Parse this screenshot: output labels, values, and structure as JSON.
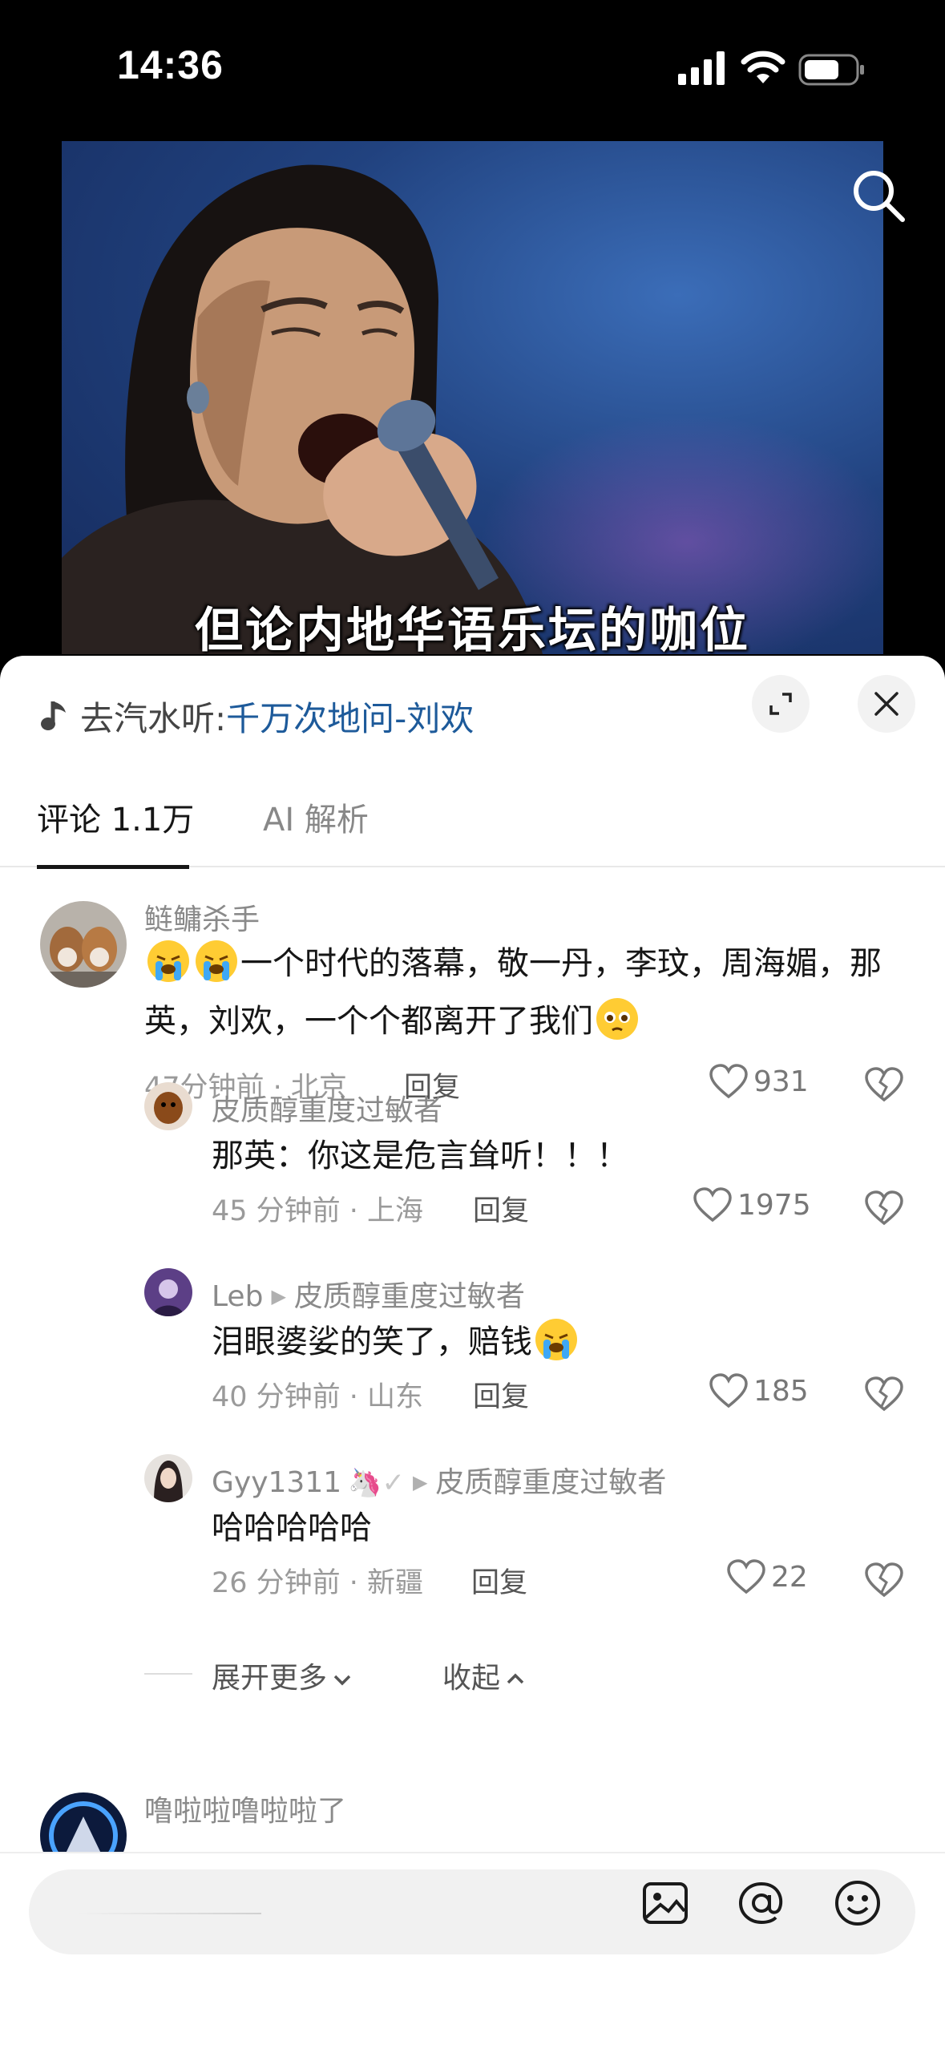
{
  "status_bar": {
    "time": "14:36"
  },
  "video": {
    "subtitle": "但论内地华语乐坛的咖位"
  },
  "panel": {
    "music_prefix": "去汽水听:",
    "music_title": "千万次地问-刘欢",
    "tabs": [
      {
        "label": "评论 1.1万"
      },
      {
        "label": "AI 解析"
      }
    ]
  },
  "comments": [
    {
      "user": "鲢鳙杀手",
      "text_before": "",
      "text": "一个时代的落幕，敬一丹，李玟，周海媚，那英，刘欢，一个个都离开了我们",
      "meta": "47分钟前 · 北京",
      "reply": "回复",
      "likes": "931"
    }
  ],
  "replies": [
    {
      "user": "皮质醇重度过敏者",
      "text": "那英：你这是危言耸听！！！",
      "meta": "45 分钟前 · 上海",
      "reply": "回复",
      "likes": "1975"
    },
    {
      "user": "Leb",
      "reply_to": "皮质醇重度过敏者",
      "text": "泪眼婆娑的笑了，赔钱",
      "meta": "40 分钟前 · 山东",
      "reply": "回复",
      "likes": "185"
    },
    {
      "user": "Gyy1311",
      "reply_to": "皮质醇重度过敏者",
      "text": "哈哈哈哈哈",
      "meta": "26 分钟前 · 新疆",
      "reply": "回复",
      "likes": "22"
    }
  ],
  "expand": {
    "more": "展开更多",
    "collapse": "收起"
  },
  "next_comment": {
    "user": "噜啦啦噜啦啦了"
  },
  "icons": {
    "search": "search-icon",
    "music": "music-note-icon",
    "expand": "expand-icon",
    "close": "close-icon",
    "like": "heart-icon",
    "dislike": "broken-heart-icon",
    "image": "image-icon",
    "mention": "at-icon",
    "emoji": "emoji-icon"
  },
  "colors": {
    "accent_link": "#1d5a9a",
    "text_primary": "#161616",
    "text_secondary": "#8a8a8a"
  }
}
